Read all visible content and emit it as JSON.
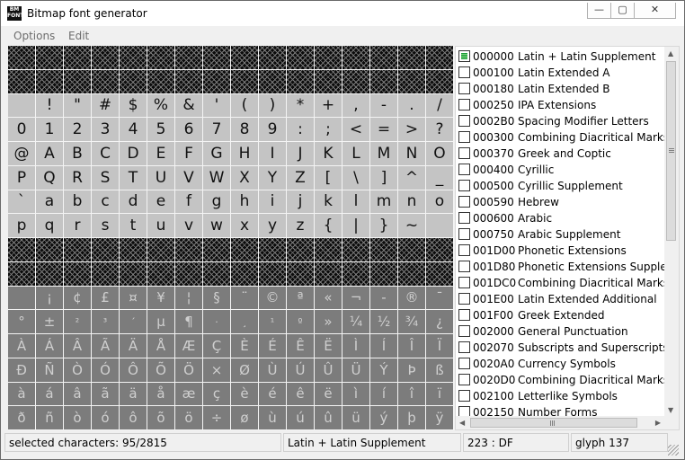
{
  "window": {
    "title": "Bitmap font generator",
    "icon_text": "BM FONT"
  },
  "titlebar_buttons": {
    "minimize": "—",
    "maximize": "▢",
    "close": "✕"
  },
  "menu": {
    "options": "Options",
    "edit": "Edit"
  },
  "glyph_grid": {
    "rows": [
      {
        "state": "empty",
        "glyphs": [
          "",
          "",
          "",
          "",
          "",
          "",
          "",
          "",
          "",
          "",
          "",
          "",
          "",
          "",
          "",
          ""
        ]
      },
      {
        "state": "empty",
        "glyphs": [
          "",
          "",
          "",
          "",
          "",
          "",
          "",
          "",
          "",
          "",
          "",
          "",
          "",
          "",
          "",
          ""
        ]
      },
      {
        "state": "selected",
        "glyphs": [
          "",
          "!",
          "\"",
          "#",
          "$",
          "%",
          "&",
          "'",
          "(",
          ")",
          "*",
          "+",
          ",",
          "-",
          ".",
          "/"
        ]
      },
      {
        "state": "selected",
        "glyphs": [
          "0",
          "1",
          "2",
          "3",
          "4",
          "5",
          "6",
          "7",
          "8",
          "9",
          ":",
          ";",
          "<",
          "=",
          ">",
          "?"
        ]
      },
      {
        "state": "selected",
        "glyphs": [
          "@",
          "A",
          "B",
          "C",
          "D",
          "E",
          "F",
          "G",
          "H",
          "I",
          "J",
          "K",
          "L",
          "M",
          "N",
          "O"
        ]
      },
      {
        "state": "selected",
        "glyphs": [
          "P",
          "Q",
          "R",
          "S",
          "T",
          "U",
          "V",
          "W",
          "X",
          "Y",
          "Z",
          "[",
          "\\",
          "]",
          "^",
          "_"
        ]
      },
      {
        "state": "selected",
        "glyphs": [
          "`",
          "a",
          "b",
          "c",
          "d",
          "e",
          "f",
          "g",
          "h",
          "i",
          "j",
          "k",
          "l",
          "m",
          "n",
          "o"
        ]
      },
      {
        "state": "selected",
        "glyphs": [
          "p",
          "q",
          "r",
          "s",
          "t",
          "u",
          "v",
          "w",
          "x",
          "y",
          "z",
          "{",
          "|",
          "}",
          "~",
          ""
        ]
      },
      {
        "state": "empty",
        "glyphs": [
          "",
          "",
          "",
          "",
          "",
          "",
          "",
          "",
          "",
          "",
          "",
          "",
          "",
          "",
          "",
          ""
        ]
      },
      {
        "state": "empty",
        "glyphs": [
          "",
          "",
          "",
          "",
          "",
          "",
          "",
          "",
          "",
          "",
          "",
          "",
          "",
          "",
          "",
          ""
        ]
      },
      {
        "state": "unselected",
        "glyphs": [
          "",
          "¡",
          "¢",
          "£",
          "¤",
          "¥",
          "¦",
          "§",
          "¨",
          "©",
          "ª",
          "«",
          "¬",
          "-",
          "®",
          "¯"
        ]
      },
      {
        "state": "unselected",
        "glyphs": [
          "°",
          "±",
          "²",
          "³",
          "´",
          "µ",
          "¶",
          "·",
          "¸",
          "¹",
          "º",
          "»",
          "¼",
          "½",
          "¾",
          "¿"
        ]
      },
      {
        "state": "unselected",
        "glyphs": [
          "À",
          "Á",
          "Â",
          "Ã",
          "Ä",
          "Å",
          "Æ",
          "Ç",
          "È",
          "É",
          "Ê",
          "Ë",
          "Ì",
          "Í",
          "Î",
          "Ï"
        ]
      },
      {
        "state": "unselected",
        "glyphs": [
          "Ð",
          "Ñ",
          "Ò",
          "Ó",
          "Ô",
          "Õ",
          "Ö",
          "×",
          "Ø",
          "Ù",
          "Ú",
          "Û",
          "Ü",
          "Ý",
          "Þ",
          "ß"
        ]
      },
      {
        "state": "unselected",
        "glyphs": [
          "à",
          "á",
          "â",
          "ã",
          "ä",
          "å",
          "æ",
          "ç",
          "è",
          "é",
          "ê",
          "ë",
          "ì",
          "í",
          "î",
          "ï"
        ]
      },
      {
        "state": "unselected",
        "glyphs": [
          "ð",
          "ñ",
          "ò",
          "ó",
          "ô",
          "õ",
          "ö",
          "÷",
          "ø",
          "ù",
          "ú",
          "û",
          "ü",
          "ý",
          "þ",
          "ÿ"
        ]
      }
    ]
  },
  "blocks": [
    {
      "code": "000000",
      "name": "Latin + Latin Supplement",
      "checked": true
    },
    {
      "code": "000100",
      "name": "Latin Extended A",
      "checked": false
    },
    {
      "code": "000180",
      "name": "Latin Extended B",
      "checked": false
    },
    {
      "code": "000250",
      "name": "IPA Extensions",
      "checked": false
    },
    {
      "code": "0002B0",
      "name": "Spacing Modifier Letters",
      "checked": false
    },
    {
      "code": "000300",
      "name": "Combining Diacritical Marks",
      "checked": false
    },
    {
      "code": "000370",
      "name": "Greek and Coptic",
      "checked": false
    },
    {
      "code": "000400",
      "name": "Cyrillic",
      "checked": false
    },
    {
      "code": "000500",
      "name": "Cyrillic Supplement",
      "checked": false
    },
    {
      "code": "000590",
      "name": "Hebrew",
      "checked": false
    },
    {
      "code": "000600",
      "name": "Arabic",
      "checked": false
    },
    {
      "code": "000750",
      "name": "Arabic Supplement",
      "checked": false
    },
    {
      "code": "001D00",
      "name": "Phonetic Extensions",
      "checked": false
    },
    {
      "code": "001D80",
      "name": "Phonetic Extensions Supple.",
      "checked": false
    },
    {
      "code": "001DC0",
      "name": "Combining Diacritical Marks",
      "checked": false
    },
    {
      "code": "001E00",
      "name": "Latin Extended Additional",
      "checked": false
    },
    {
      "code": "001F00",
      "name": "Greek Extended",
      "checked": false
    },
    {
      "code": "002000",
      "name": "General Punctuation",
      "checked": false
    },
    {
      "code": "002070",
      "name": "Subscripts and Superscripts",
      "checked": false
    },
    {
      "code": "0020A0",
      "name": "Currency Symbols",
      "checked": false
    },
    {
      "code": "0020D0",
      "name": "Combining Diacritical Marks",
      "checked": false
    },
    {
      "code": "002100",
      "name": "Letterlike Symbols",
      "checked": false
    },
    {
      "code": "002150",
      "name": "Number Forms",
      "checked": false
    }
  ],
  "status": {
    "selected": "selected characters: 95/2815",
    "block": "Latin + Latin Supplement",
    "code": "223 : DF",
    "glyph": "glyph 137"
  }
}
